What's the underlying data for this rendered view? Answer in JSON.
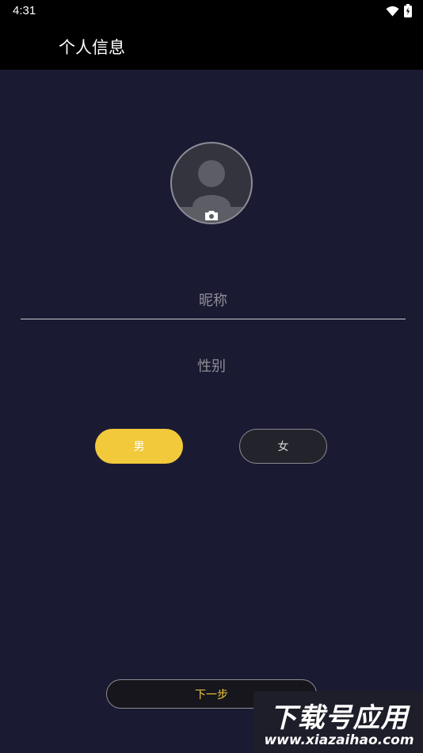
{
  "status_bar": {
    "time": "4:31",
    "wifi_icon": "wifi-icon",
    "battery_icon": "battery-charging-icon"
  },
  "app_bar": {
    "title": "个人信息"
  },
  "avatar": {
    "placeholder_icon": "person-silhouette-icon",
    "camera_icon": "camera-icon"
  },
  "form": {
    "nickname_placeholder": "昵称",
    "nickname_value": "",
    "gender_label": "性别",
    "gender_options": [
      "男",
      "女"
    ],
    "gender_selected": "男"
  },
  "actions": {
    "next_label": "下一步"
  },
  "watermark": {
    "title": "下载号应用",
    "url": "www.xiazaihao.com"
  },
  "colors": {
    "background": "#1b1a33",
    "bar": "#000000",
    "accent": "#f1c93a",
    "muted_text": "#8e8e96"
  }
}
